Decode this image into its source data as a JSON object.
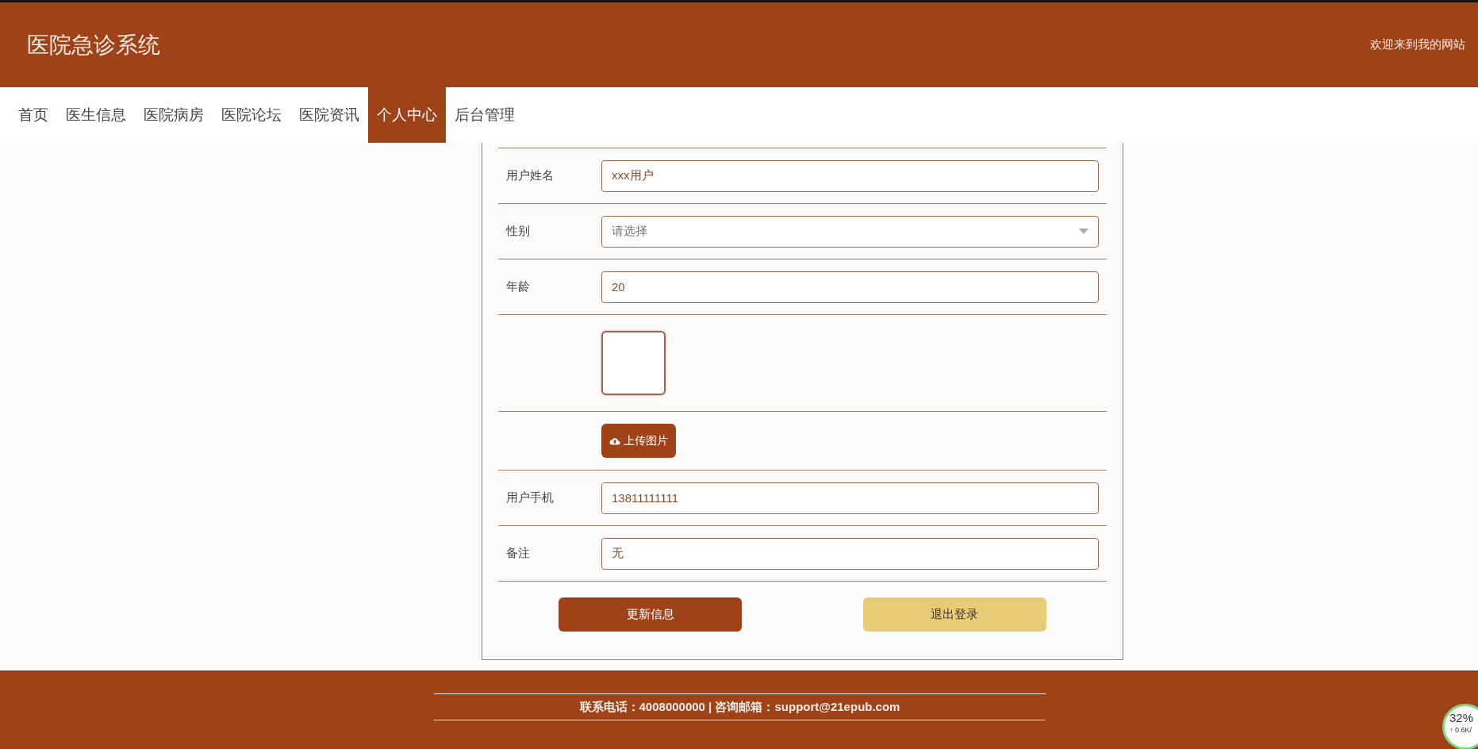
{
  "header": {
    "title": "医院急诊系统",
    "welcome": "欢迎来到我的网站"
  },
  "nav": [
    {
      "label": "首页",
      "selected": false
    },
    {
      "label": "医生信息",
      "selected": false
    },
    {
      "label": "医院病房",
      "selected": false
    },
    {
      "label": "医院论坛",
      "selected": false
    },
    {
      "label": "医院资讯",
      "selected": false
    },
    {
      "label": "个人中心",
      "selected": true
    },
    {
      "label": "后台管理",
      "selected": false
    }
  ],
  "form": {
    "rows": [
      {
        "kind": "input",
        "label": "用户姓名",
        "value": "xxx用户"
      },
      {
        "kind": "select",
        "label": "性别",
        "placeholder": "请选择"
      },
      {
        "kind": "input",
        "label": "年龄",
        "value": "20"
      },
      {
        "kind": "image"
      },
      {
        "kind": "upload",
        "button": "上传图片"
      },
      {
        "kind": "input",
        "label": "用户手机",
        "value": "13811111111"
      },
      {
        "kind": "input",
        "label": "备注",
        "value": "无"
      }
    ],
    "buttons": [
      {
        "label": "更新信息",
        "kind": "primary"
      },
      {
        "label": "退出登录",
        "kind": "secondary"
      }
    ]
  },
  "footer": {
    "contact": "联系电话：4008000000 | 咨询邮箱：support@21epub.com"
  },
  "speed_widget": {
    "percent": "32%",
    "rate": "↑ 0.6K/"
  }
}
